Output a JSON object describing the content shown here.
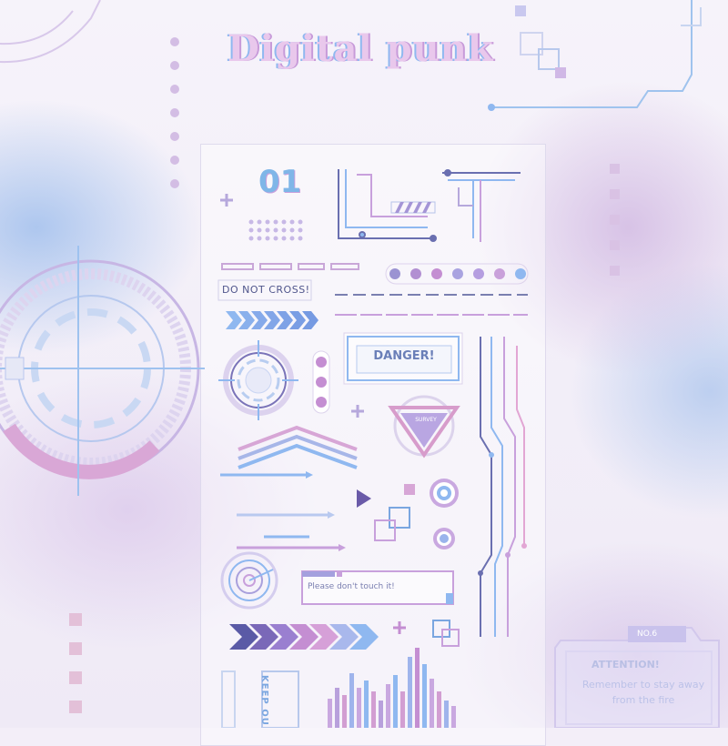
{
  "title": "Digital punk",
  "stickers": {
    "number": "01",
    "do_not_cross": "DO NOT CROSS!",
    "danger": "DANGER!",
    "survey": "SURVEY",
    "please_dont_touch": "Please don't touch it!",
    "keep_out": "KEEP OU"
  },
  "attention_panel": {
    "number": "NO.6",
    "heading": "ATTENTION!",
    "message": "Remember to stay away from the fire"
  },
  "colors": {
    "blue": "#8fb8f0",
    "lilac": "#c8a0dc",
    "navy": "#50568c",
    "pink": "#e2a6d4"
  }
}
